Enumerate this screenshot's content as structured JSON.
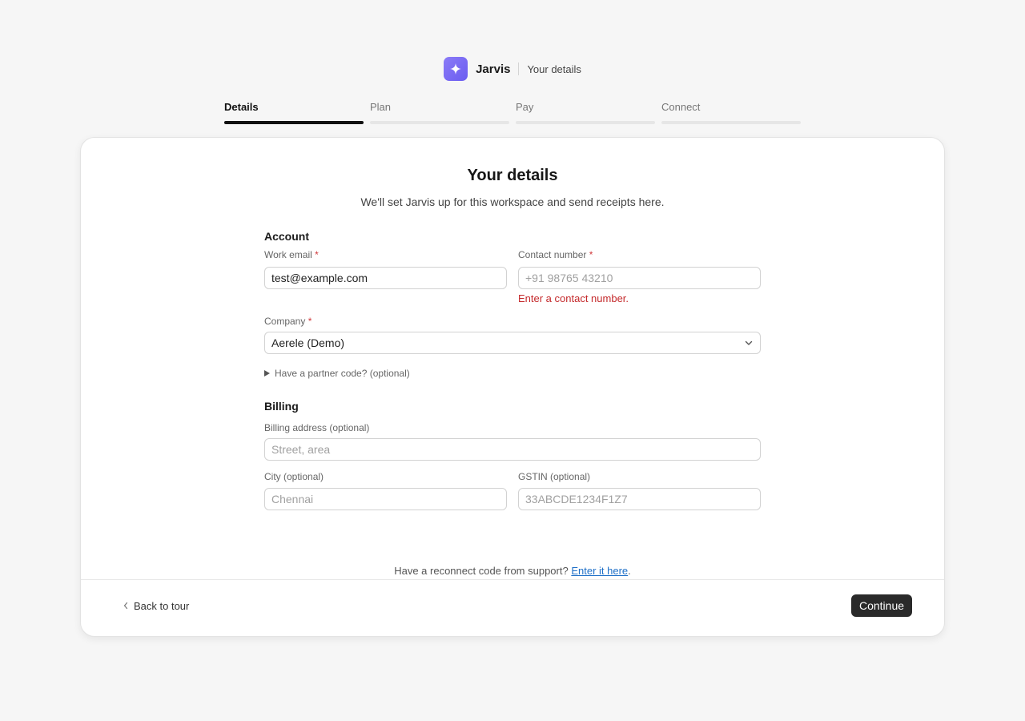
{
  "header": {
    "logo_icon": "sparkle-icon",
    "brand": "Jarvis",
    "subtitle": "Your details",
    "accent_color": "#7b6cf6"
  },
  "steps": [
    {
      "label": "Details",
      "active": true
    },
    {
      "label": "Plan",
      "active": false
    },
    {
      "label": "Pay",
      "active": false
    },
    {
      "label": "Connect",
      "active": false
    }
  ],
  "card": {
    "title": "Your details",
    "subtitle": "We'll set Jarvis up for this workspace and send receipts here."
  },
  "account": {
    "section_title": "Account",
    "email_label": "Work email",
    "email_value": "test@example.com",
    "contact_label": "Contact number",
    "contact_placeholder": "+91 98765 43210",
    "contact_error": "Enter a contact number.",
    "company_label": "Company",
    "company_value": "Aerele (Demo)",
    "partner_code_label": "Have a partner code? (optional)",
    "required_mark": "*"
  },
  "billing": {
    "section_title": "Billing",
    "address_label": "Billing address (optional)",
    "address_placeholder": "Street, area",
    "city_label": "City (optional)",
    "city_placeholder": "Chennai",
    "gstin_label": "GSTIN (optional)",
    "gstin_placeholder": "33ABCDE1234F1Z7"
  },
  "footer": {
    "reconnect_text": "Have a reconnect code from support?",
    "reconnect_link": "Enter it here",
    "reconnect_period": ".",
    "back_label": "Back to tour",
    "continue_label": "Continue",
    "error_color": "#c4292b"
  }
}
